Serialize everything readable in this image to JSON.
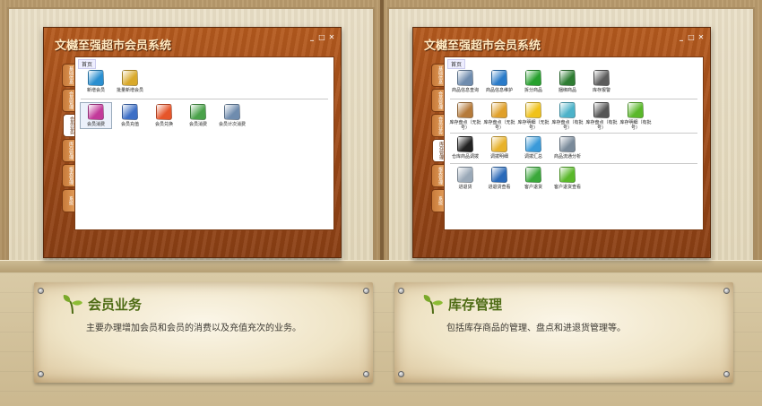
{
  "app": {
    "title": "文樾至强超市会员系统",
    "window_controls": [
      "_",
      "□",
      "✕"
    ]
  },
  "panels": {
    "member": {
      "breadcrumb": "首页",
      "side_tabs": [
        "基础信息",
        "会员管理",
        "会员业务",
        "库存管理",
        "报表管理",
        "系统"
      ],
      "active_tab_index": 2,
      "row1": [
        {
          "label": "新增会员",
          "icon": "add-member-icon",
          "color": "#2a8fd0"
        },
        {
          "label": "批量新增会员",
          "icon": "batch-member-icon",
          "color": "#d9a92a"
        }
      ],
      "row2": [
        {
          "label": "会员消费",
          "icon": "consume-icon",
          "color": "#c23a9a"
        },
        {
          "label": "会员充值",
          "icon": "recharge-icon",
          "color": "#3d6fc6"
        },
        {
          "label": "会员兑换",
          "icon": "redeem-icon",
          "color": "#e6552a"
        },
        {
          "label": "会员消费",
          "icon": "member-person-icon",
          "color": "#4aa24a"
        },
        {
          "label": "会员计次消费",
          "icon": "count-consume-icon",
          "color": "#6f8cae"
        }
      ]
    },
    "inventory": {
      "breadcrumb": "首页",
      "side_tabs": [
        "基础信息",
        "会员管理",
        "会员业务",
        "库存管理",
        "报表管理",
        "系统"
      ],
      "active_tab_index": 3,
      "row1": [
        {
          "label": "商品信息查询",
          "icon": "search-icon",
          "color": "#6f8cae"
        },
        {
          "label": "商品信息维护",
          "icon": "globe-icon",
          "color": "#2a7bc9"
        },
        {
          "label": "拆分商品",
          "icon": "split-icon",
          "color": "#27a02e"
        },
        {
          "label": "捆绑商品",
          "icon": "bundle-icon",
          "color": "#2e7d32"
        },
        {
          "label": "库存报警",
          "icon": "alarm-icon",
          "color": "#5c5c5c"
        }
      ],
      "row2": [
        {
          "label": "库存盘点（无批号）",
          "icon": "box-icon",
          "color": "#b57a3a"
        },
        {
          "label": "库存盘点（无批号）",
          "icon": "cart-icon",
          "color": "#e0a02a"
        },
        {
          "label": "库存明细（无批号）",
          "icon": "pencil-icon",
          "color": "#f0c21a"
        },
        {
          "label": "库存盘点（有批号）",
          "icon": "monitor-icon",
          "color": "#4cb2c9"
        },
        {
          "label": "库存盘点（有批号）",
          "icon": "book-icon",
          "color": "#555555"
        },
        {
          "label": "库存明细（有批号）",
          "icon": "tag-icon",
          "color": "#5ab82a"
        }
      ],
      "row3": [
        {
          "label": "仓库商品调拨",
          "icon": "warehouse-icon",
          "color": "#222222"
        },
        {
          "label": "调拨明细",
          "icon": "folder-icon",
          "color": "#e8b22a"
        },
        {
          "label": "调拨汇总",
          "icon": "chat-icon",
          "color": "#3a9ad9"
        },
        {
          "label": "商品流通分析",
          "icon": "chart-icon",
          "color": "#7a8a9a"
        }
      ],
      "row4": [
        {
          "label": "进退货",
          "icon": "document-icon",
          "color": "#9aa9b8"
        },
        {
          "label": "进退货查看",
          "icon": "stack-icon",
          "color": "#2a6ab9"
        },
        {
          "label": "客户退货",
          "icon": "customer-icon",
          "color": "#3aa83a"
        },
        {
          "label": "客户退货查看",
          "icon": "leaf-icon",
          "color": "#5ab82a"
        }
      ]
    }
  },
  "boards": {
    "member": {
      "title": "会员业务",
      "desc": "主要办理增加会员和会员的消费以及充值充次的业务。"
    },
    "inventory": {
      "title": "库存管理",
      "desc": "包括库存商品的管理、盘点和进退货管理等。"
    }
  }
}
